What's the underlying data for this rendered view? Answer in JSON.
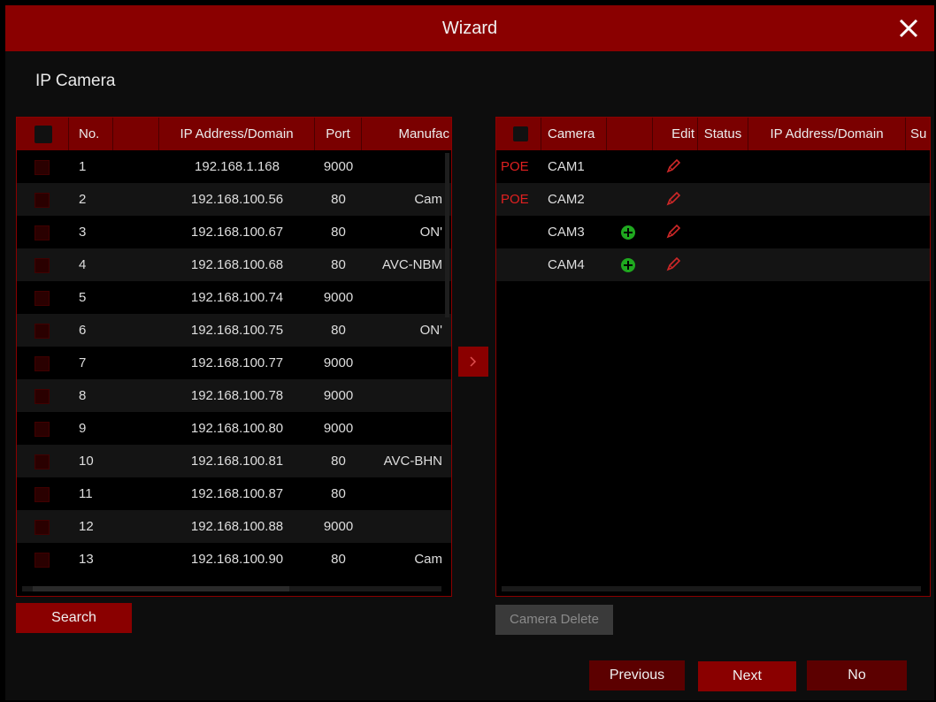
{
  "window": {
    "title": "Wizard"
  },
  "section_title": "IP Camera",
  "search_table": {
    "headers": [
      "No.",
      "",
      "IP Address/Domain",
      "Port",
      "Manufac"
    ],
    "rows": [
      {
        "no": "1",
        "ip": "192.168.1.168",
        "port": "9000",
        "manufacturer": ""
      },
      {
        "no": "2",
        "ip": "192.168.100.56",
        "port": "80",
        "manufacturer": "Cam"
      },
      {
        "no": "3",
        "ip": "192.168.100.67",
        "port": "80",
        "manufacturer": "ON'"
      },
      {
        "no": "4",
        "ip": "192.168.100.68",
        "port": "80",
        "manufacturer": "AVC-NBM"
      },
      {
        "no": "5",
        "ip": "192.168.100.74",
        "port": "9000",
        "manufacturer": ""
      },
      {
        "no": "6",
        "ip": "192.168.100.75",
        "port": "80",
        "manufacturer": "ON'"
      },
      {
        "no": "7",
        "ip": "192.168.100.77",
        "port": "9000",
        "manufacturer": ""
      },
      {
        "no": "8",
        "ip": "192.168.100.78",
        "port": "9000",
        "manufacturer": ""
      },
      {
        "no": "9",
        "ip": "192.168.100.80",
        "port": "9000",
        "manufacturer": ""
      },
      {
        "no": "10",
        "ip": "192.168.100.81",
        "port": "80",
        "manufacturer": "AVC-BHN"
      },
      {
        "no": "11",
        "ip": "192.168.100.87",
        "port": "80",
        "manufacturer": ""
      },
      {
        "no": "12",
        "ip": "192.168.100.88",
        "port": "9000",
        "manufacturer": ""
      },
      {
        "no": "13",
        "ip": "192.168.100.90",
        "port": "80",
        "manufacturer": "Cam"
      }
    ]
  },
  "camera_table": {
    "headers": [
      "Camera",
      "",
      "Edit",
      "Status",
      "IP Address/Domain",
      "Su"
    ],
    "rows": [
      {
        "tag": "POE",
        "camera": "CAM1",
        "add": false
      },
      {
        "tag": "POE",
        "camera": "CAM2",
        "add": false
      },
      {
        "tag": "",
        "camera": "CAM3",
        "add": true
      },
      {
        "tag": "",
        "camera": "CAM4",
        "add": true
      }
    ]
  },
  "buttons": {
    "search": "Search",
    "camera_delete": "Camera Delete",
    "previous": "Previous",
    "next": "Next",
    "no": "No",
    "move": ">"
  },
  "colors": {
    "accent": "#8a0000",
    "header": "#7a0000",
    "poe": "#e02020",
    "add_icon": "#1fa81f"
  }
}
